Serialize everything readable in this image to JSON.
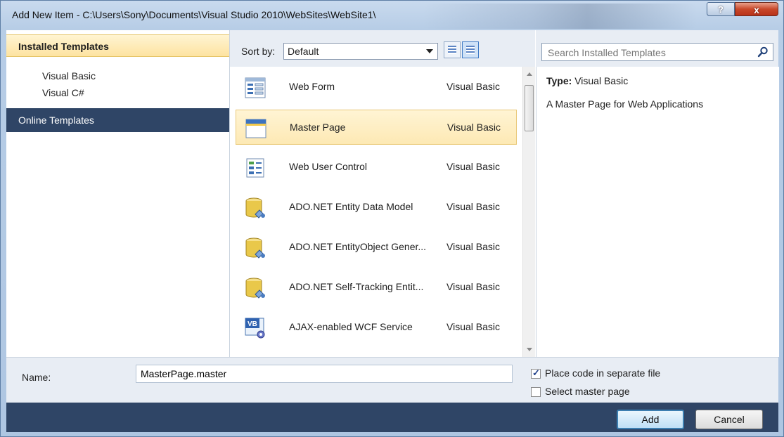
{
  "window": {
    "title": "Add New Item - C:\\Users\\Sony\\Documents\\Visual Studio 2010\\WebSites\\WebSite1\\",
    "help_glyph": "?",
    "close_glyph": "x"
  },
  "left_panel": {
    "header": "Installed Templates",
    "items": [
      {
        "label": "Visual Basic"
      },
      {
        "label": "Visual C#"
      }
    ],
    "online": "Online Templates"
  },
  "toolbar": {
    "sort_label": "Sort by:",
    "sort_value": "Default"
  },
  "search": {
    "placeholder": "Search Installed Templates",
    "icon": "search-icon"
  },
  "templates": [
    {
      "name": "Web Form",
      "language": "Visual Basic",
      "icon": "web-form-icon"
    },
    {
      "name": "Master Page",
      "language": "Visual Basic",
      "icon": "master-page-icon",
      "selected": true
    },
    {
      "name": "Web User Control",
      "language": "Visual Basic",
      "icon": "user-control-icon"
    },
    {
      "name": "ADO.NET Entity Data Model",
      "language": "Visual Basic",
      "icon": "database-icon"
    },
    {
      "name": "ADO.NET EntityObject Gener...",
      "language": "Visual Basic",
      "icon": "database-icon"
    },
    {
      "name": "ADO.NET Self-Tracking Entit...",
      "language": "Visual Basic",
      "icon": "database-icon"
    },
    {
      "name": "AJAX-enabled WCF Service",
      "language": "Visual Basic",
      "icon": "wcf-service-icon"
    }
  ],
  "details": {
    "type_label": "Type:",
    "type_value": "Visual Basic",
    "description": "A Master Page for Web Applications"
  },
  "name_row": {
    "label": "Name:",
    "value": "MasterPage.master"
  },
  "options": {
    "separate_file": {
      "label": "Place code in separate file",
      "checked": true
    },
    "master_page": {
      "label": "Select master page",
      "checked": false
    }
  },
  "buttons": {
    "add": "Add",
    "cancel": "Cancel"
  },
  "colors": {
    "accent_dark": "#2f4566",
    "selection": "#fde9b4"
  }
}
